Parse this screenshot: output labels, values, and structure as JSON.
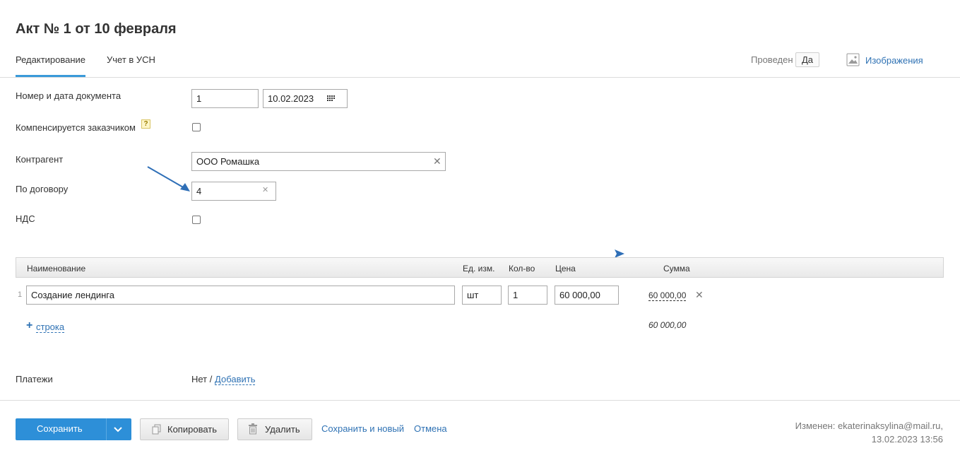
{
  "title": "Акт № 1 от 10 февраля",
  "tabs": [
    {
      "label": "Редактирование",
      "active": true
    },
    {
      "label": "Учет в УСН",
      "active": false
    }
  ],
  "header": {
    "posted_label": "Проведен",
    "posted_value": "Да",
    "images_label": "Изображения"
  },
  "form": {
    "number_date_label": "Номер и дата документа",
    "number_value": "1",
    "date_value": "10.02.2023",
    "compensated_label": "Компенсируется заказчиком",
    "compensated_checked": false,
    "help_glyph": "?",
    "counterparty_label": "Контрагент",
    "counterparty_value": "ООО Ромашка",
    "contract_label": "По договору",
    "contract_value": "4",
    "vat_label": "НДС",
    "vat_checked": false
  },
  "table": {
    "headers": {
      "name": "Наименование",
      "unit": "Ед. изм.",
      "qty": "Кол-во",
      "price": "Цена",
      "sum": "Сумма"
    },
    "rows": [
      {
        "num": "1",
        "name": "Создание лендинга",
        "unit": "шт",
        "qty": "1",
        "price": "60 000,00",
        "sum": "60 000,00"
      }
    ],
    "add_row_plus": "+",
    "add_row_label": "строка",
    "total": "60 000,00"
  },
  "payments": {
    "label": "Платежи",
    "value": "Нет",
    "separator": "/",
    "add_label": "Добавить"
  },
  "footer": {
    "save_label": "Сохранить",
    "copy_label": "Копировать",
    "delete_label": "Удалить",
    "save_new_label": "Сохранить и новый",
    "cancel_label": "Отмена",
    "modified_label": "Изменен: ekaterinaksylina@mail.ru,",
    "modified_time": "13.02.2023 13:56"
  },
  "colors": {
    "accent": "#2d8fd8",
    "link": "#2f72b4",
    "annotation_arrow": "#2f6fb7"
  },
  "icons": {
    "calendar": "calendar-icon",
    "clear": "close-icon",
    "image": "image-icon",
    "chevron": "chevron-down-icon",
    "copy": "copy-icon",
    "delete": "trash-icon",
    "help": "help-icon"
  }
}
